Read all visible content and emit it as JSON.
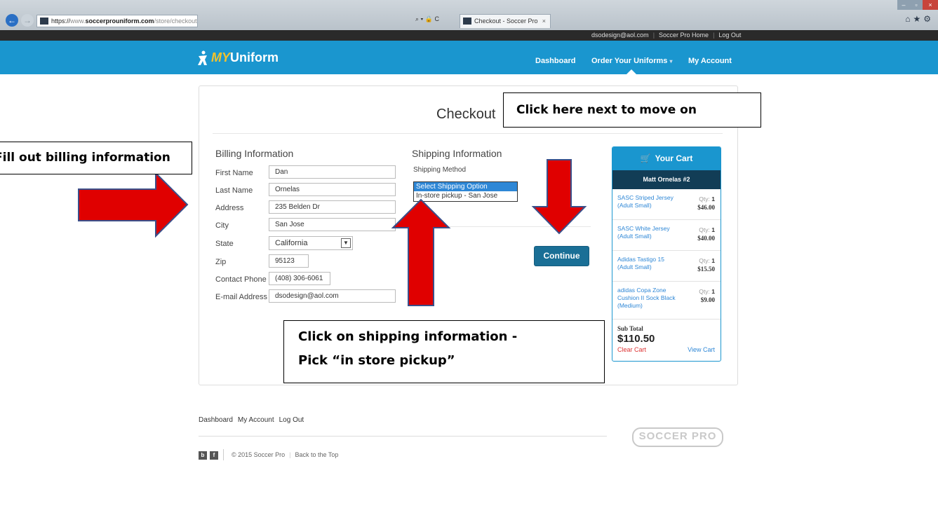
{
  "browser": {
    "url_scheme": "https://",
    "url_www": "www.",
    "url_domain": "soccerprouniform.com",
    "url_path": "/store/checkout",
    "tab_title": "Checkout - Soccer Pro"
  },
  "toplinks": {
    "email": "dsodesign@aol.com",
    "home": "Soccer Pro Home",
    "logout": "Log Out"
  },
  "header": {
    "logo_my": "MY",
    "logo_text": "Uniform",
    "nav": [
      "Dashboard",
      "Order Your Uniforms",
      "My Account"
    ]
  },
  "page": {
    "title": "Checkout"
  },
  "billing": {
    "title": "Billing Information",
    "fields": [
      {
        "label": "First Name",
        "value": "Dan"
      },
      {
        "label": "Last Name",
        "value": "Ornelas"
      },
      {
        "label": "Address",
        "value": "235 Belden Dr"
      },
      {
        "label": "City",
        "value": "San Jose"
      },
      {
        "label": "State",
        "value": "California"
      },
      {
        "label": "Zip",
        "value": "95123"
      },
      {
        "label": "Contact Phone",
        "value": "(408) 306-6061"
      },
      {
        "label": "E-mail Address",
        "value": "dsodesign@aol.com"
      }
    ]
  },
  "shipping": {
    "title": "Shipping Information",
    "method_label": "Shipping Method",
    "options": [
      "Select Shipping Option",
      "In-store pickup - San Jose"
    ],
    "continue_label": "Continue"
  },
  "cart": {
    "title": "Your Cart",
    "player": "Matt Ornelas #2",
    "qty_label": "Qty:",
    "items": [
      {
        "name": "SASC Striped Jersey (Adult Small)",
        "qty": "1",
        "price": "$46.00"
      },
      {
        "name": "SASC White Jersey (Adult Small)",
        "qty": "1",
        "price": "$40.00"
      },
      {
        "name": "Adidas Tastigo 15 (Adult Small)",
        "qty": "1",
        "price": "$15.50"
      },
      {
        "name": "adidas Copa Zone Cushion II Sock Black (Medium)",
        "qty": "1",
        "price": "$9.00"
      }
    ],
    "subtotal_label": "Sub Total",
    "subtotal": "$110.50",
    "clear": "Clear Cart",
    "view": "View Cart"
  },
  "footer": {
    "links": [
      "Dashboard",
      "My Account",
      "Log Out"
    ],
    "copyright": "© 2015 Soccer Pro",
    "back_to_top": "Back to the Top",
    "brand": "SOCCER PRO"
  },
  "annotations": {
    "billing": "Fill out billing information",
    "next": "Click here next to move on",
    "ship_line1": "Click on shipping information -",
    "ship_line2": "Pick “in store pickup”"
  },
  "colors": {
    "navbar": "#1a96cf",
    "continue": "#1a6f96",
    "arrow": "#e00000",
    "arrow_outline": "#3b4f8a"
  }
}
